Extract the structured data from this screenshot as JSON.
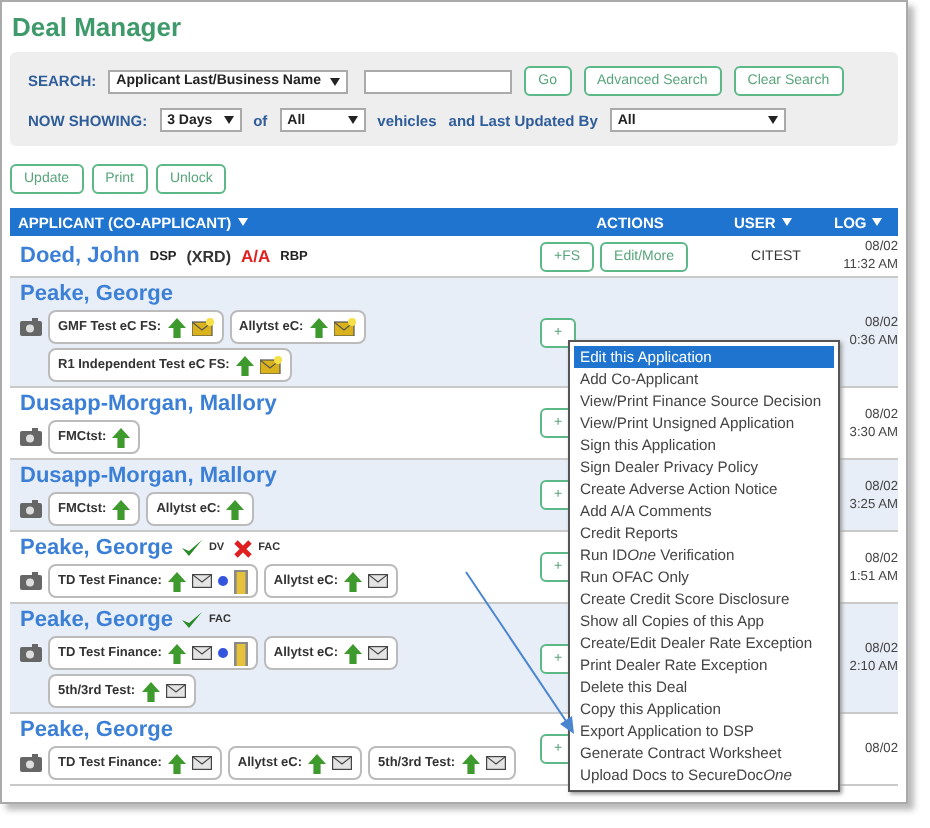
{
  "title": "Deal Manager",
  "filters": {
    "search_label": "SEARCH:",
    "search_by": "Applicant Last/Business Name",
    "go": "Go",
    "advanced": "Advanced Search",
    "clear": "Clear Search",
    "showing_label": "NOW SHOWING:",
    "period": "3 Days",
    "of": "of",
    "vehicles_filter": "All",
    "vehicles": "vehicles",
    "updated_by_label": "and Last Updated By",
    "updated_by": "All"
  },
  "toolbar": [
    "Update",
    "Print",
    "Unlock"
  ],
  "table": {
    "columns": [
      "APPLICANT (CO-APPLICANT)",
      "ACTIONS",
      "USER",
      "LOG"
    ],
    "rows": [
      {
        "name": "Doed, John",
        "tags": [
          {
            "text": "DSP",
            "kind": "plain"
          },
          {
            "text": "(XRD)",
            "kind": "paren"
          },
          {
            "text": "A/A",
            "kind": "alert"
          },
          {
            "text": "RBP",
            "kind": "plain"
          }
        ],
        "actions": [
          "+FS",
          "Edit/More"
        ],
        "user": "CITEST",
        "log": [
          "08/02",
          "11:32 AM"
        ]
      },
      {
        "name": "Peake, George",
        "chip_rows": [
          [
            {
              "label": "GMF Test eC FS:",
              "icons": [
                {
                  "kind": "arrow"
                },
                {
                  "kind": "mail-new"
                }
              ]
            },
            {
              "label": "Allytst eC:",
              "icons": [
                {
                  "kind": "arrow"
                },
                {
                  "kind": "mail-new"
                }
              ]
            }
          ],
          [
            {
              "label": "R1 Independent Test eC FS:",
              "icons": [
                {
                  "kind": "arrow"
                },
                {
                  "kind": "mail-new"
                }
              ]
            }
          ]
        ],
        "actions": [
          "+"
        ],
        "log": [
          "08/02",
          "0:36 AM"
        ]
      },
      {
        "name": "Dusapp-Morgan, Mallory",
        "chip_rows": [
          [
            {
              "label": "FMCtst:",
              "icons": [
                {
                  "kind": "arrow"
                }
              ]
            }
          ]
        ],
        "actions": [
          "+"
        ],
        "log": [
          "08/02",
          "3:30 AM"
        ]
      },
      {
        "name": "Dusapp-Morgan, Mallory",
        "chip_rows": [
          [
            {
              "label": "FMCtst:",
              "icons": [
                {
                  "kind": "arrow"
                }
              ]
            },
            {
              "label": "Allytst eC:",
              "icons": [
                {
                  "kind": "arrow"
                }
              ]
            }
          ]
        ],
        "actions": [
          "+"
        ],
        "log": [
          "08/02",
          "3:25 AM"
        ]
      },
      {
        "name": "Peake, George",
        "status": [
          {
            "kind": "check",
            "label": "DV"
          },
          {
            "kind": "cross",
            "label": "FAC"
          }
        ],
        "chip_rows": [
          [
            {
              "label": "TD Test Finance:",
              "icons": [
                {
                  "kind": "arrow"
                },
                {
                  "kind": "mail"
                },
                {
                  "kind": "dot"
                },
                {
                  "kind": "door"
                }
              ]
            },
            {
              "label": "Allytst eC:",
              "icons": [
                {
                  "kind": "arrow"
                },
                {
                  "kind": "mail"
                }
              ]
            }
          ]
        ],
        "actions": [
          "+"
        ],
        "log": [
          "08/02",
          "1:51 AM"
        ]
      },
      {
        "name": "Peake, George",
        "status": [
          {
            "kind": "check",
            "label": "FAC"
          }
        ],
        "chip_rows": [
          [
            {
              "label": "TD Test Finance:",
              "icons": [
                {
                  "kind": "arrow"
                },
                {
                  "kind": "mail"
                },
                {
                  "kind": "dot"
                },
                {
                  "kind": "door"
                }
              ]
            },
            {
              "label": "Allytst eC:",
              "icons": [
                {
                  "kind": "arrow"
                },
                {
                  "kind": "mail"
                }
              ]
            }
          ],
          [
            {
              "label": "5th/3rd Test:",
              "icons": [
                {
                  "kind": "arrow"
                },
                {
                  "kind": "mail"
                }
              ]
            }
          ]
        ],
        "actions": [
          "+"
        ],
        "log": [
          "08/02",
          "2:10 AM"
        ]
      },
      {
        "name": "Peake, George",
        "chip_rows": [
          [
            {
              "label": "TD Test Finance:",
              "icons": [
                {
                  "kind": "arrow"
                },
                {
                  "kind": "mail"
                }
              ]
            },
            {
              "label": "Allytst eC:",
              "icons": [
                {
                  "kind": "arrow"
                },
                {
                  "kind": "mail"
                }
              ]
            },
            {
              "label": "5th/3rd Test:",
              "icons": [
                {
                  "kind": "arrow"
                },
                {
                  "kind": "mail"
                }
              ]
            }
          ]
        ],
        "actions": [
          "+"
        ],
        "log": [
          "08/02"
        ]
      }
    ]
  },
  "context_menu": [
    {
      "label": "Edit this Application",
      "selected": true
    },
    {
      "label": "Add Co-Applicant",
      "selected": false
    },
    {
      "label": "View/Print Finance Source Decision",
      "selected": false
    },
    {
      "label": "View/Print Unsigned Application",
      "selected": false
    },
    {
      "label": "Sign this Application",
      "selected": false
    },
    {
      "label": "Sign Dealer Privacy Policy",
      "selected": false
    },
    {
      "label": "Create Adverse Action Notice",
      "selected": false
    },
    {
      "label": "Add A/A Comments",
      "selected": false
    },
    {
      "label": "Credit Reports",
      "selected": false
    },
    {
      "label": "Run ID",
      "italic_part": "One",
      "label_end": " Verification",
      "selected": false
    },
    {
      "label": "Run OFAC Only",
      "selected": false
    },
    {
      "label": "Create Credit Score Disclosure",
      "selected": false
    },
    {
      "label": "Show all Copies of this App",
      "selected": false
    },
    {
      "label": "Create/Edit Dealer Rate Exception",
      "selected": false
    },
    {
      "label": "Print Dealer Rate Exception",
      "selected": false
    },
    {
      "label": "Delete this Deal",
      "selected": false
    },
    {
      "label": "Copy this Application",
      "selected": false
    },
    {
      "label": "Export Application to DSP",
      "selected": false
    },
    {
      "label": "Generate Contract Worksheet",
      "selected": false
    },
    {
      "label": "Upload Docs to SecureDoc",
      "italic_part": "One",
      "selected": false
    }
  ]
}
